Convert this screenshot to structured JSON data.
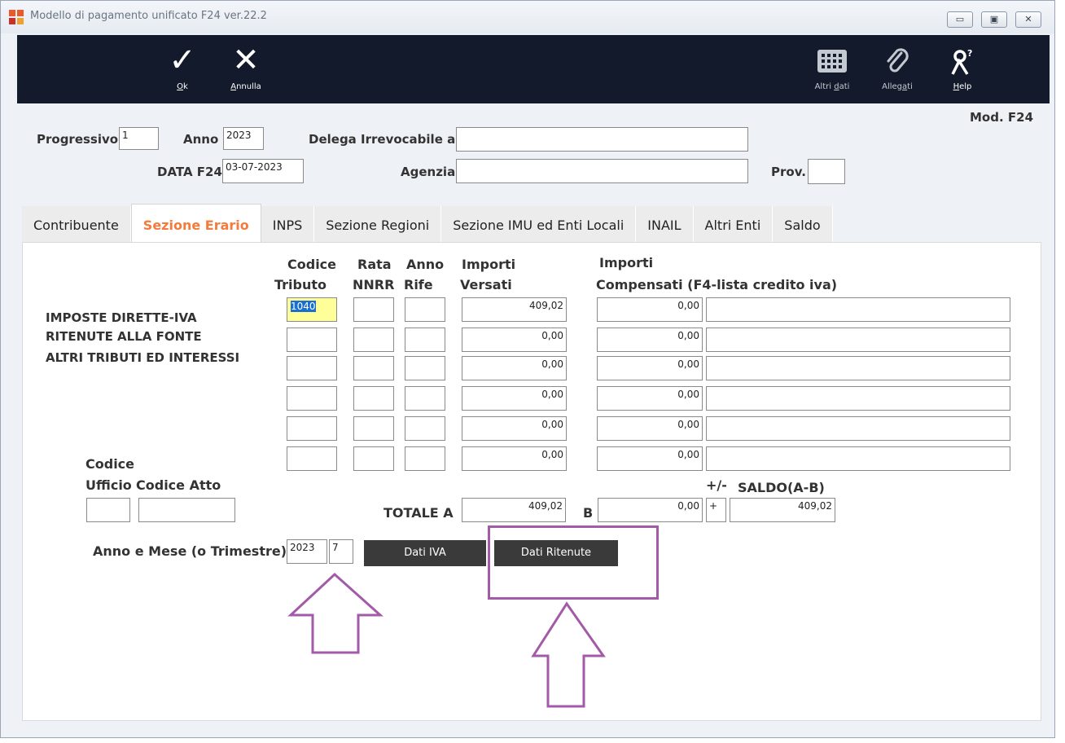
{
  "window": {
    "title": "Modello di pagamento unificato F24 ver.22.2",
    "minimize": "▭",
    "maximize": "▣",
    "close": "✕"
  },
  "toolbar": {
    "ok_label": "Ok",
    "cancel_label": "Annulla",
    "altri_dati_label": "Altri dati",
    "allegati_label": "Allegati",
    "help_label": "Help"
  },
  "header": {
    "mod_label": "Mod. F24",
    "progressivo_label": "Progressivo",
    "progressivo_value": "1",
    "anno_label": "Anno",
    "anno_value": "2023",
    "delega_label": "Delega Irrevocabile a",
    "delega_value": "",
    "data_label": "DATA F24",
    "data_value": "03-07-2023",
    "agenzia_label": "Agenzia",
    "agenzia_value": "",
    "prov_label": "Prov.",
    "prov_value": ""
  },
  "tabs": [
    {
      "label": "Contribuente"
    },
    {
      "label": "Sezione Erario"
    },
    {
      "label": "INPS"
    },
    {
      "label": "Sezione Regioni"
    },
    {
      "label": "Sezione IMU ed Enti Locali"
    },
    {
      "label": "INAIL"
    },
    {
      "label": "Altri Enti"
    },
    {
      "label": "Saldo"
    }
  ],
  "erario": {
    "col_codice_1": "Codice",
    "col_codice_2": "Tributo",
    "col_rata_1": "Rata",
    "col_rata_2": "NNRR",
    "col_anno_1": "Anno",
    "col_anno_2": "Rife",
    "col_versati_1": "Importi",
    "col_versati_2": "Versati",
    "col_compensati_1": "Importi",
    "col_compensati_2": "Compensati (F4-lista credito iva)",
    "section_line1": "IMPOSTE DIRETTE-IVA",
    "section_line2": "RITENUTE ALLA FONTE",
    "section_line3": "ALTRI TRIBUTI ED INTERESSI",
    "rows": [
      {
        "codice": "1040",
        "rata": "",
        "anno": "",
        "versati": "409,02",
        "compensati": "0,00",
        "note": ""
      },
      {
        "codice": "",
        "rata": "",
        "anno": "",
        "versati": "0,00",
        "compensati": "0,00",
        "note": ""
      },
      {
        "codice": "",
        "rata": "",
        "anno": "",
        "versati": "0,00",
        "compensati": "0,00",
        "note": ""
      },
      {
        "codice": "",
        "rata": "",
        "anno": "",
        "versati": "0,00",
        "compensati": "0,00",
        "note": ""
      },
      {
        "codice": "",
        "rata": "",
        "anno": "",
        "versati": "0,00",
        "compensati": "0,00",
        "note": ""
      },
      {
        "codice": "",
        "rata": "",
        "anno": "",
        "versati": "0,00",
        "compensati": "0,00",
        "note": ""
      }
    ],
    "codice_ufficio_1": "Codice",
    "codice_ufficio_2": "Ufficio",
    "codice_atto": "Codice Atto",
    "ufficio_value": "",
    "atto_value": "",
    "totale_a_label": "TOTALE  A",
    "totale_a_value": "409,02",
    "b_label": "B",
    "totale_b_value": "0,00",
    "pm_label": "+/-",
    "pm_value": "+",
    "saldo_label": "SALDO(A-B)",
    "saldo_value": "409,02",
    "anno_mese_label": "Anno e Mese (o Trimestre)",
    "anno_mese_anno": "2023",
    "anno_mese_mese": "7",
    "dati_iva_label": "Dati IVA",
    "dati_ritenute_label": "Dati Ritenute"
  },
  "colors": {
    "toolbar_bg": "#131a2b",
    "active_tab": "#f47b3c",
    "annotation": "#a35aa8",
    "selected_field_bg": "#ffff99",
    "selection_highlight": "#1a6fd1"
  }
}
